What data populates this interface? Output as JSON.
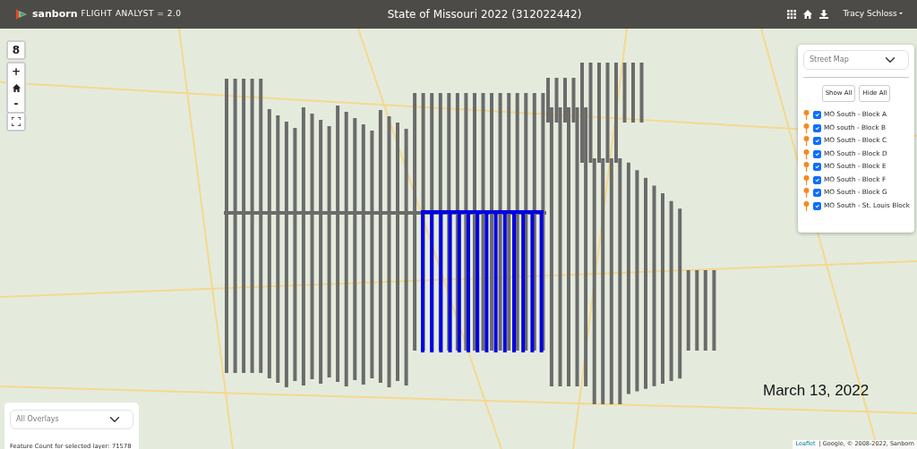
{
  "header": {
    "app_name": "sanborn",
    "app_subtitle": "FLIGHT ANALYST = 2.0",
    "title": "State of Missouri 2022 (312022442)",
    "user": "Tracy Schloss"
  },
  "map_controls": {
    "layer_count": "8",
    "zoom_in": "+",
    "zoom_out": "-"
  },
  "layer_panel": {
    "basemap": "Street Map",
    "show_all": "Show All",
    "hide_all": "Hide All",
    "layers": [
      {
        "label": "MO South - Block A",
        "checked": true
      },
      {
        "label": "MO south - Block B",
        "checked": true
      },
      {
        "label": "MO South - Block C",
        "checked": true
      },
      {
        "label": "MO South - Block D",
        "checked": true
      },
      {
        "label": "MO South - Block E",
        "checked": true
      },
      {
        "label": "MO South - Block F",
        "checked": true
      },
      {
        "label": "MO South - Block G",
        "checked": true
      },
      {
        "label": "MO South - St. Louis Block",
        "checked": true
      }
    ]
  },
  "overlay_panel": {
    "overlay": "All Overlays",
    "feature_count": "Feature Count for selected layer: 71578"
  },
  "date_label": "March 13, 2022",
  "attribution": {
    "link": "Leaflet",
    "text": "| Google, © 2008-2022, Sanborn"
  }
}
